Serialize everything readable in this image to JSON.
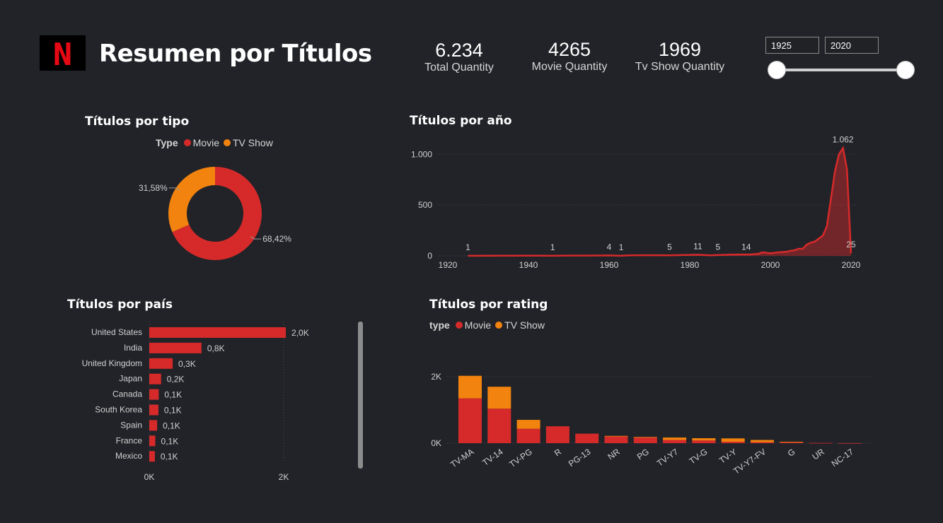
{
  "header": {
    "title": "Resumen por Títulos",
    "logo_letter": "N",
    "kpis": [
      {
        "value": "6.234",
        "label": "Total Quantity"
      },
      {
        "value": "4265",
        "label": "Movie Quantity"
      },
      {
        "value": "1969",
        "label": "Tv Show Quantity"
      }
    ],
    "year_range": {
      "start": "1925",
      "end": "2020"
    }
  },
  "colors": {
    "movie": "#d62a2a",
    "tvshow": "#f1830e",
    "background": "#212328",
    "brand": "#e50914"
  },
  "chart_data": [
    {
      "type": "pie",
      "title": "Títulos por tipo",
      "legend_title": "Type",
      "legend_position": "top",
      "slices": [
        {
          "name": "Movie",
          "value": 68.42,
          "label": "68,42%",
          "color": "#d62a2a"
        },
        {
          "name": "TV Show",
          "value": 31.58,
          "label": "31,58%",
          "color": "#f1830e"
        }
      ]
    },
    {
      "type": "area",
      "title": "Títulos por año",
      "xlim": [
        1920,
        2020
      ],
      "ylim": [
        0,
        1100
      ],
      "x_ticks": [
        "1920",
        "1940",
        "1960",
        "1980",
        "2000",
        "2020"
      ],
      "y_ticks": [
        "0",
        "500",
        "1.000"
      ],
      "grid": true,
      "x": [
        1925,
        1940,
        1946,
        1950,
        1955,
        1960,
        1963,
        1965,
        1970,
        1975,
        1980,
        1982,
        1985,
        1990,
        1992,
        1995,
        1997,
        1998,
        2000,
        2002,
        2004,
        2005,
        2006,
        2007,
        2008,
        2009,
        2010,
        2011,
        2012,
        2013,
        2014,
        2015,
        2016,
        2017,
        2018,
        2019,
        2020
      ],
      "y": [
        1,
        2,
        1,
        3,
        3,
        4,
        1,
        5,
        6,
        5,
        10,
        11,
        5,
        12,
        13,
        14,
        20,
        35,
        25,
        35,
        40,
        50,
        55,
        70,
        70,
        110,
        130,
        140,
        170,
        200,
        290,
        560,
        830,
        1000,
        1062,
        850,
        25
      ],
      "data_labels": [
        {
          "x": 1925,
          "text": "1"
        },
        {
          "x": 1946,
          "text": "1"
        },
        {
          "x": 1960,
          "text": "4"
        },
        {
          "x": 1963,
          "text": "1"
        },
        {
          "x": 1975,
          "text": "5"
        },
        {
          "x": 1982,
          "text": "11"
        },
        {
          "x": 1987,
          "text": "5"
        },
        {
          "x": 1994,
          "text": "14"
        },
        {
          "x": 2018,
          "text": "1.062"
        },
        {
          "x": 2020,
          "text": "25"
        }
      ]
    },
    {
      "type": "bar",
      "orientation": "horizontal",
      "title": "Títulos por país",
      "categories": [
        "United States",
        "India",
        "United Kingdom",
        "Japan",
        "Canada",
        "South Korea",
        "Spain",
        "France",
        "Mexico"
      ],
      "values": [
        2032,
        777,
        348,
        176,
        141,
        136,
        117,
        90,
        83
      ],
      "labels": [
        "2,0K",
        "0,8K",
        "0,3K",
        "0,2K",
        "0,1K",
        "0,1K",
        "0,1K",
        "0,1K",
        "0,1K"
      ],
      "xlim": [
        0,
        2000
      ],
      "x_ticks": [
        "0K",
        "2K"
      ],
      "color": "#d62a2a"
    },
    {
      "type": "bar",
      "stacked": true,
      "title": "Títulos por rating",
      "legend_title": "type",
      "legend_position": "top",
      "categories": [
        "TV-MA",
        "TV-14",
        "TV-PG",
        "R",
        "PG-13",
        "NR",
        "PG",
        "TV-Y7",
        "TV-G",
        "TV-Y",
        "TV-Y7-FV",
        "G",
        "UR",
        "NC-17"
      ],
      "series": [
        {
          "name": "Movie",
          "color": "#d62a2a",
          "values": [
            1348,
            1038,
            432,
            508,
            286,
            202,
            183,
            95,
            80,
            41,
            27,
            36,
            7,
            2
          ]
        },
        {
          "name": "TV Show",
          "color": "#f1830e",
          "values": [
            679,
            660,
            269,
            0,
            0,
            16,
            1,
            74,
            69,
            102,
            68,
            1,
            0,
            0
          ]
        }
      ],
      "ylim": [
        0,
        2200
      ],
      "y_ticks": [
        "0K",
        "2K"
      ]
    }
  ]
}
